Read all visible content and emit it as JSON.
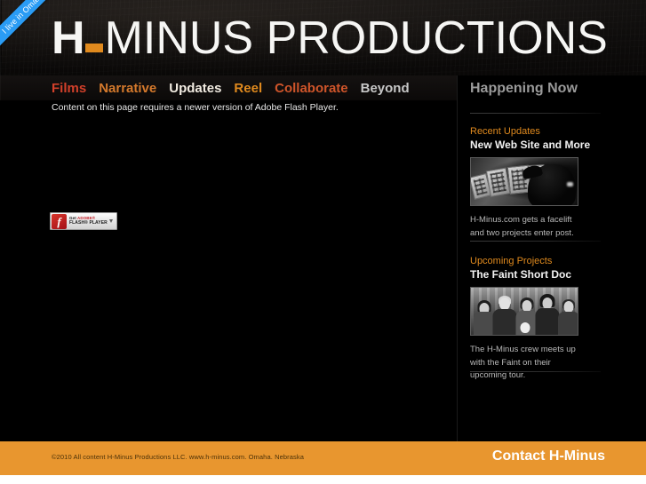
{
  "ribbon": {
    "text": "I live in Omaha"
  },
  "logo": {
    "h": "H",
    "dash_icon": "orange-dash",
    "rest": "MINUS PRODUCTIONS"
  },
  "nav": {
    "items": [
      {
        "label": "Films",
        "color": "#d2402a"
      },
      {
        "label": "Narrative",
        "color": "#d4792c"
      },
      {
        "label": "Updates",
        "color": "#f2ece2"
      },
      {
        "label": "Reel",
        "color": "#e08a1e"
      },
      {
        "label": "Collaborate",
        "color": "#cf552a"
      },
      {
        "label": "Beyond",
        "color": "#c7c7c7"
      }
    ]
  },
  "stage": {
    "flash_message": "Content on this page requires a newer version of Adobe Flash Player.",
    "flash_badge": {
      "logo_glyph": "f",
      "line1_prefix": "Get ",
      "line1_brand": "ADOBE®",
      "line2": "FLASH® PLAYER",
      "download_icon": "download-arrow-icon"
    }
  },
  "sidebar": {
    "title": "Happening Now",
    "panels": [
      {
        "kicker": "Recent Updates",
        "headline": "New Web Site and More",
        "thumb_alt": "contact-sheets-photo",
        "description": "H-Minus.com gets a facelift and two projects enter post."
      },
      {
        "kicker": "Upcoming Projects",
        "headline": "The Faint Short Doc",
        "thumb_alt": "band-group-photo",
        "description": "The H-Minus crew meets up with the Faint on their upcoming tour."
      }
    ]
  },
  "footer": {
    "copyright": "©2010 All content H-Minus Productions LLC. www.h-minus.com. Omaha. Nebraska",
    "contact_label": "Contact H-Minus",
    "background_color": "#e8962f"
  },
  "colors": {
    "accent_orange": "#e08a1e",
    "footer_orange": "#e8962f",
    "ribbon_blue": "#2a9cf5",
    "background_black": "#000000"
  }
}
